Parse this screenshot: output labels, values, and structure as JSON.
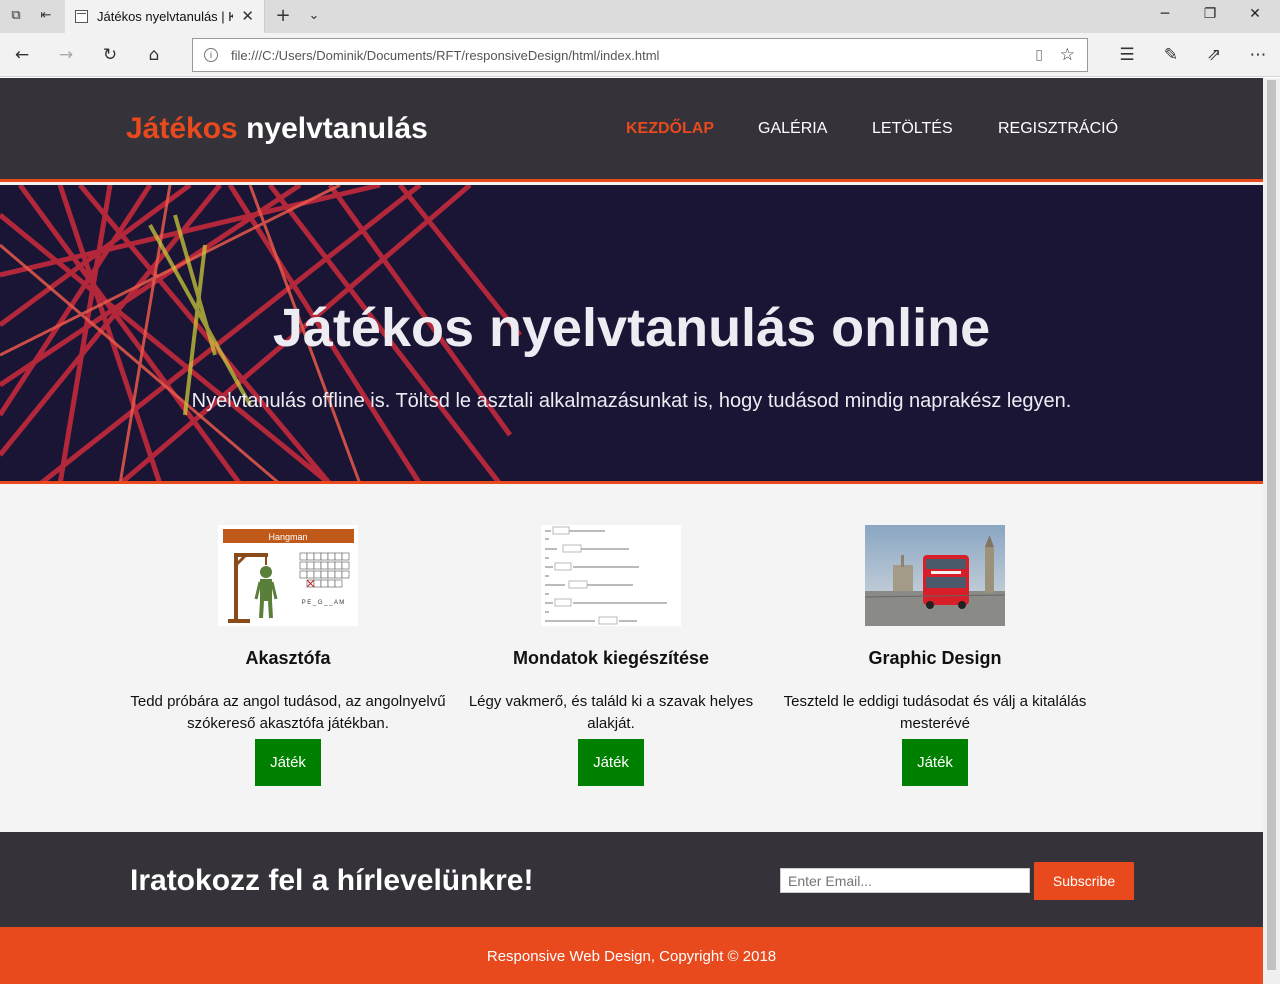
{
  "browser": {
    "tab_title": "Játékos nyelvtanulás | K",
    "url": "file:///C:/Users/Dominik/Documents/RFT/responsiveDesign/html/index.html"
  },
  "header": {
    "logo_highlight": "Játékos",
    "logo_rest": " nyelvtanulás",
    "nav": [
      {
        "label": "KEZDŐLAP",
        "active": true
      },
      {
        "label": "GALÉRIA",
        "active": false
      },
      {
        "label": "LETÖLTÉS",
        "active": false
      },
      {
        "label": "REGISZTRÁCIÓ",
        "active": false
      }
    ]
  },
  "showcase": {
    "title": "Játékos nyelvtanulás online",
    "subtitle": "Nyelvtanulás offline is. Töltsd le asztali alkalmazásunkat is, hogy tudásod mindig naprakész legyen."
  },
  "boxes": [
    {
      "title": "Akasztófa",
      "text": "Tedd próbára az angol tudásod, az angolnyelvű szókereső akasztófa játékban.",
      "button": "Játék",
      "image_label": "Hangman",
      "image_word": "P E _ G _ _ A M"
    },
    {
      "title": "Mondatok kiegészítése",
      "text": "Légy vakmerő, és találd ki a szavak helyes alakját.",
      "button": "Játék"
    },
    {
      "title": "Graphic Design",
      "text": "Teszteld le eddigi tudásodat és válj a kitalálás mesterévé",
      "button": "Játék"
    }
  ],
  "newsletter": {
    "title": "Iratokozz fel a hírlevelünkre!",
    "email_placeholder": "Enter Email...",
    "subscribe_label": "Subscribe"
  },
  "footer": {
    "copyright": "Responsive Web Design, Copyright © 2018"
  },
  "colors": {
    "accent": "#e8491d",
    "dark": "#35323a",
    "button_green": "#008000"
  }
}
